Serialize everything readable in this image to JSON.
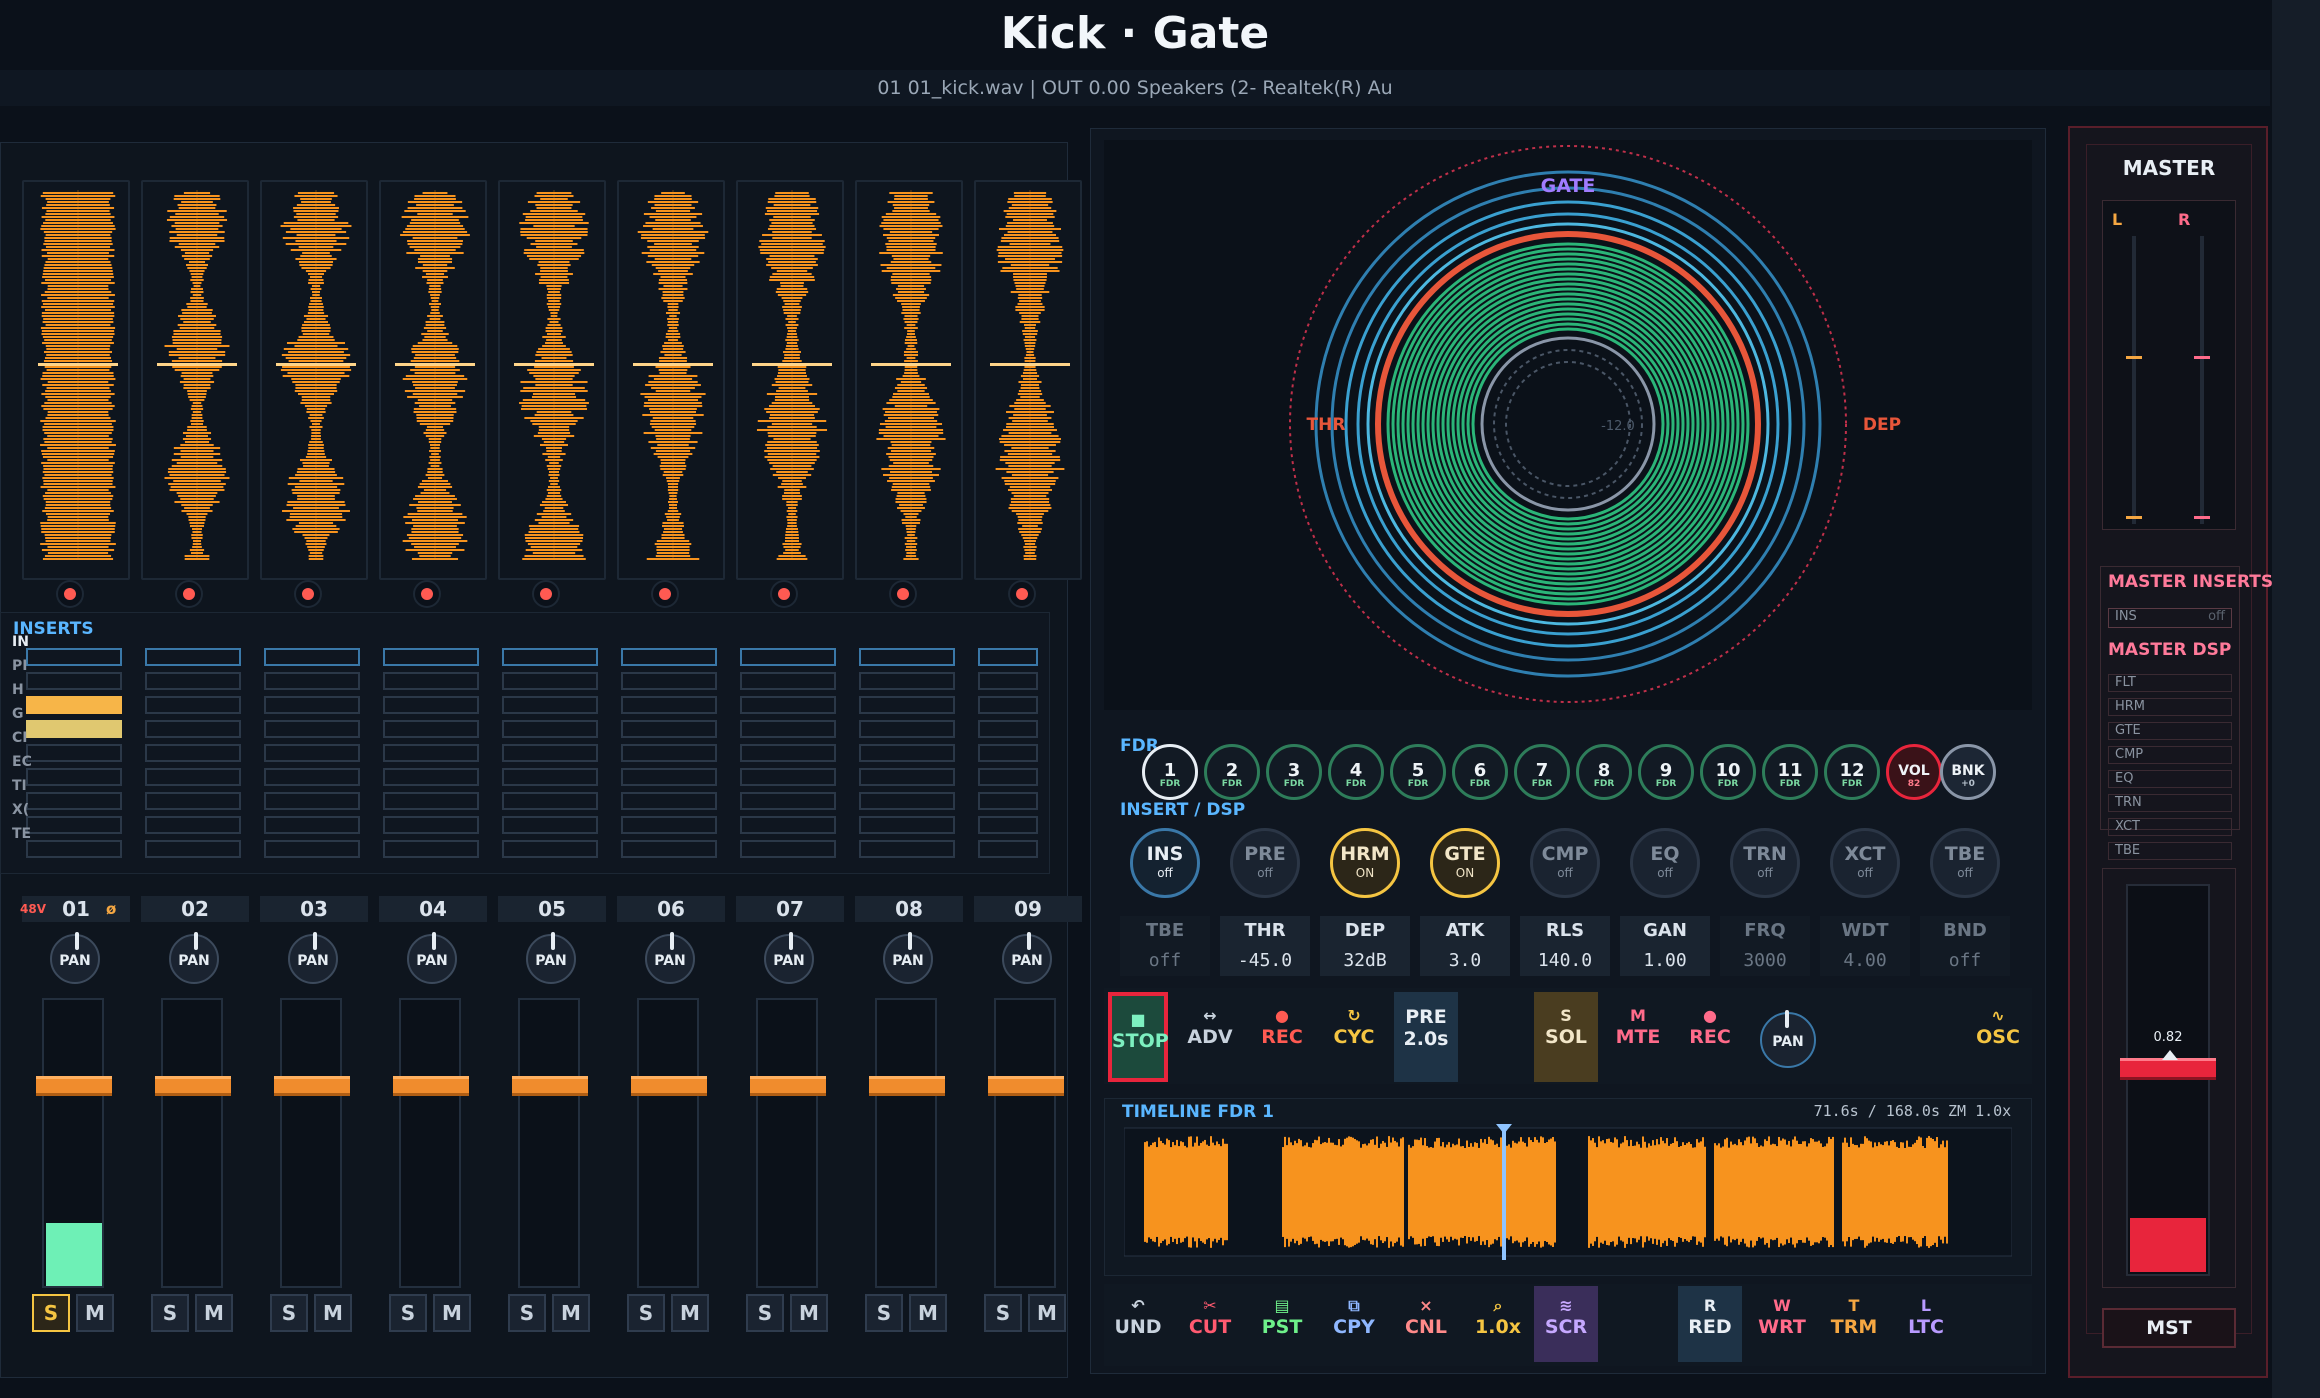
{
  "header": {
    "title": "Kick · Gate",
    "subtitle": "01  01_kick.wav  |  OUT 0.00 Speakers (2- Realtek(R) Au"
  },
  "mixer": {
    "inserts_title": "INSERTS",
    "insert_labels": [
      "IN",
      "PI",
      "H",
      "G",
      "CI",
      "EC",
      "TI",
      "X(",
      "TE"
    ],
    "channels": [
      {
        "name": "01",
        "phantom": "48V",
        "phase": "ø",
        "pan": "PAN",
        "fader": 0.84,
        "meter": 0.22,
        "solo": "S",
        "mute": "M"
      },
      {
        "name": "02",
        "pan": "PAN",
        "fader": 0.84,
        "meter": 0,
        "solo": "S",
        "mute": "M"
      },
      {
        "name": "03",
        "pan": "PAN",
        "fader": 0.84,
        "meter": 0,
        "solo": "S",
        "mute": "M"
      },
      {
        "name": "04",
        "pan": "PAN",
        "fader": 0.84,
        "meter": 0,
        "solo": "S",
        "mute": "M"
      },
      {
        "name": "05",
        "pan": "PAN",
        "fader": 0.84,
        "meter": 0,
        "solo": "S",
        "mute": "M"
      },
      {
        "name": "06",
        "pan": "PAN",
        "fader": 0.84,
        "meter": 0,
        "solo": "S",
        "mute": "M"
      },
      {
        "name": "07",
        "pan": "PAN",
        "fader": 0.84,
        "meter": 0,
        "solo": "S",
        "mute": "M"
      },
      {
        "name": "08",
        "pan": "PAN",
        "fader": 0.84,
        "meter": 0,
        "solo": "S",
        "mute": "M"
      },
      {
        "name": "09",
        "pan": "PAN",
        "fader": 0.84,
        "meter": 0,
        "solo": "S",
        "mute": "M"
      }
    ]
  },
  "gate_display": {
    "title": "GATE",
    "left_label": "THR",
    "right_label": "DEP",
    "inner_readout": "-12.0"
  },
  "fdr": {
    "label": "FDR",
    "knobs": [
      "1",
      "2",
      "3",
      "4",
      "5",
      "6",
      "7",
      "8",
      "9",
      "10",
      "11",
      "12"
    ],
    "knob_sub": "FDR",
    "vol_label": "VOL",
    "vol_value": "82",
    "bank_label": "BNK",
    "bank_value": "+0"
  },
  "insert_dsp": {
    "label": "INSERT / DSP",
    "buttons": [
      {
        "name": "INS",
        "state": "off"
      },
      {
        "name": "PRE",
        "state": "off"
      },
      {
        "name": "HRM",
        "state": "ON"
      },
      {
        "name": "GTE",
        "state": "ON"
      },
      {
        "name": "CMP",
        "state": "off"
      },
      {
        "name": "EQ",
        "state": "off"
      },
      {
        "name": "TRN",
        "state": "off"
      },
      {
        "name": "XCT",
        "state": "off"
      },
      {
        "name": "TBE",
        "state": "off"
      }
    ]
  },
  "params": [
    {
      "label": "TBE",
      "value": "off"
    },
    {
      "label": "THR",
      "value": "-45.0"
    },
    {
      "label": "DEP",
      "value": "32dB"
    },
    {
      "label": "ATK",
      "value": "3.0"
    },
    {
      "label": "RLS",
      "value": "140.0"
    },
    {
      "label": "GAN",
      "value": "1.00"
    },
    {
      "label": "FRQ",
      "value": "3000"
    },
    {
      "label": "WDT",
      "value": "4.00"
    },
    {
      "label": "BND",
      "value": "off"
    }
  ],
  "transport": {
    "stop": "STOP",
    "adv": "ADV",
    "rec": "REC",
    "cyc": "CYC",
    "pre": "PRE",
    "pre_val": "2.0s",
    "sol": "SOL",
    "sol_key": "S",
    "mte": "MTE",
    "mte_key": "M",
    "rec2": "REC",
    "pan": "PAN",
    "osc": "OSC"
  },
  "timeline": {
    "title": "TIMELINE  FDR 1",
    "position": "71.6s / 168.0s",
    "zoom": "ZM 1.0x",
    "playhead": 0.426
  },
  "edit": {
    "und": "UND",
    "cut": "CUT",
    "pst": "PST",
    "cpy": "CPY",
    "cnl": "CNL",
    "zoom": "1.0x",
    "scr": "SCR",
    "red": "RED",
    "red_key": "R",
    "wrt": "WRT",
    "wrt_key": "W",
    "trm": "TRM",
    "trm_key": "T",
    "ltc": "LTC",
    "ltc_key": "L"
  },
  "master": {
    "title": "MASTER",
    "l": "L",
    "r": "R",
    "inserts_title": "MASTER INSERTS",
    "ins": "INS",
    "ins_state": "off",
    "dsp_title": "MASTER DSP",
    "dsp": [
      "FLT",
      "HRM",
      "GTE",
      "CMP",
      "EQ",
      "TRN",
      "XCT",
      "TBE"
    ],
    "fader_value": "0.82",
    "meter": 0.14,
    "mst": "MST"
  },
  "colors": {
    "accent": "#f7931e",
    "green": "#27b574",
    "red": "#e8253c",
    "blue": "#3a78a8"
  }
}
